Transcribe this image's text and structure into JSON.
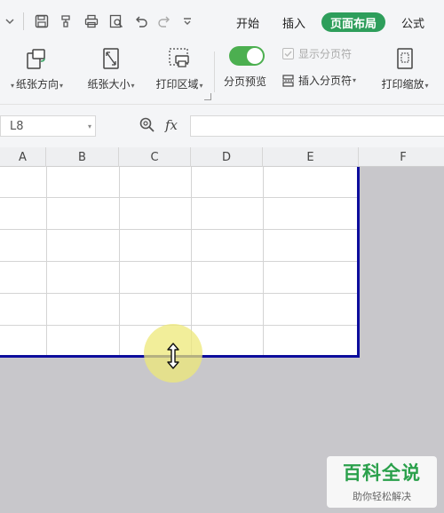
{
  "quick_access": {
    "icons": [
      "chevron-down-icon",
      "save-icon",
      "format-painter-icon",
      "print-icon",
      "print-preview-icon",
      "undo-icon",
      "redo-icon",
      "customize-icon"
    ]
  },
  "tabs": [
    {
      "label": "开始",
      "active": false
    },
    {
      "label": "插入",
      "active": false
    },
    {
      "label": "页面布局",
      "active": true
    },
    {
      "label": "公式",
      "active": false
    }
  ],
  "ribbon": {
    "orientation": "纸张方向",
    "size": "纸张大小",
    "print_area": "打印区域",
    "page_break_preview": "分页预览",
    "show_page_breaks": "显示分页符",
    "insert_page_break": "插入分页符",
    "print_scaling": "打印缩放"
  },
  "formula_bar": {
    "name_box": "L8",
    "fx": "fx",
    "formula": ""
  },
  "columns": [
    "A",
    "B",
    "C",
    "D",
    "E",
    "F"
  ],
  "watermark": {
    "title": "百科全说",
    "subtitle": "助你轻松解决"
  },
  "colors": {
    "active_tab": "#2e9e5b",
    "toggle_on": "#4caf50",
    "print_area_border": "#0d0d9c",
    "outside_area": "#c8c7cb"
  },
  "page_break_preview_enabled": true
}
